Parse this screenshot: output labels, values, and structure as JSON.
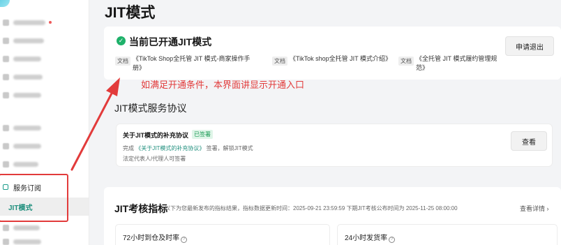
{
  "page": {
    "title": "JIT模式"
  },
  "sidebar": {
    "section_label": "服务订阅",
    "active_item_label": "JIT模式"
  },
  "status": {
    "title": "当前已开通JIT模式",
    "exit_button": "申请退出",
    "docs": [
      {
        "tag": "文档",
        "label": "《TikTok Shop全托管 JIT 模式-商家操作手册》"
      },
      {
        "tag": "文档",
        "label": "《TikTok shop全托管 JIT 模式介绍》"
      },
      {
        "tag": "文档",
        "label": "《全托管 JIT 模式履约管理规范》"
      }
    ]
  },
  "annotation": {
    "text": "如满足开通条件，本界面讲显示开通入口",
    "color": "#e23b3b"
  },
  "agreement": {
    "section_title": "JIT模式服务协议",
    "title": "关于JIT模式的补充协议",
    "badge": "已签署",
    "line1_prefix": "完成",
    "line1_link": "《关于JIT模式的补充协议》",
    "line1_suffix": "签署，解锁JIT模式",
    "line2": "法定代表人/代理人可签署",
    "view_button": "查看"
  },
  "metrics": {
    "title": "JIT考核指标",
    "note": "以下为您最新发布的指标结果，指标数据更新时间：2025-09-21 23:59:59    下期JIT考核公布时间为 2025-11-25 08:00:00",
    "view_details": "查看详情 ›",
    "boxes": [
      {
        "label": "72小时到仓及时率"
      },
      {
        "label": "24小时发货率"
      }
    ]
  },
  "colors": {
    "accent": "#1f8f7d",
    "success": "#1eb16a",
    "annotation_red": "#e23b3b"
  }
}
